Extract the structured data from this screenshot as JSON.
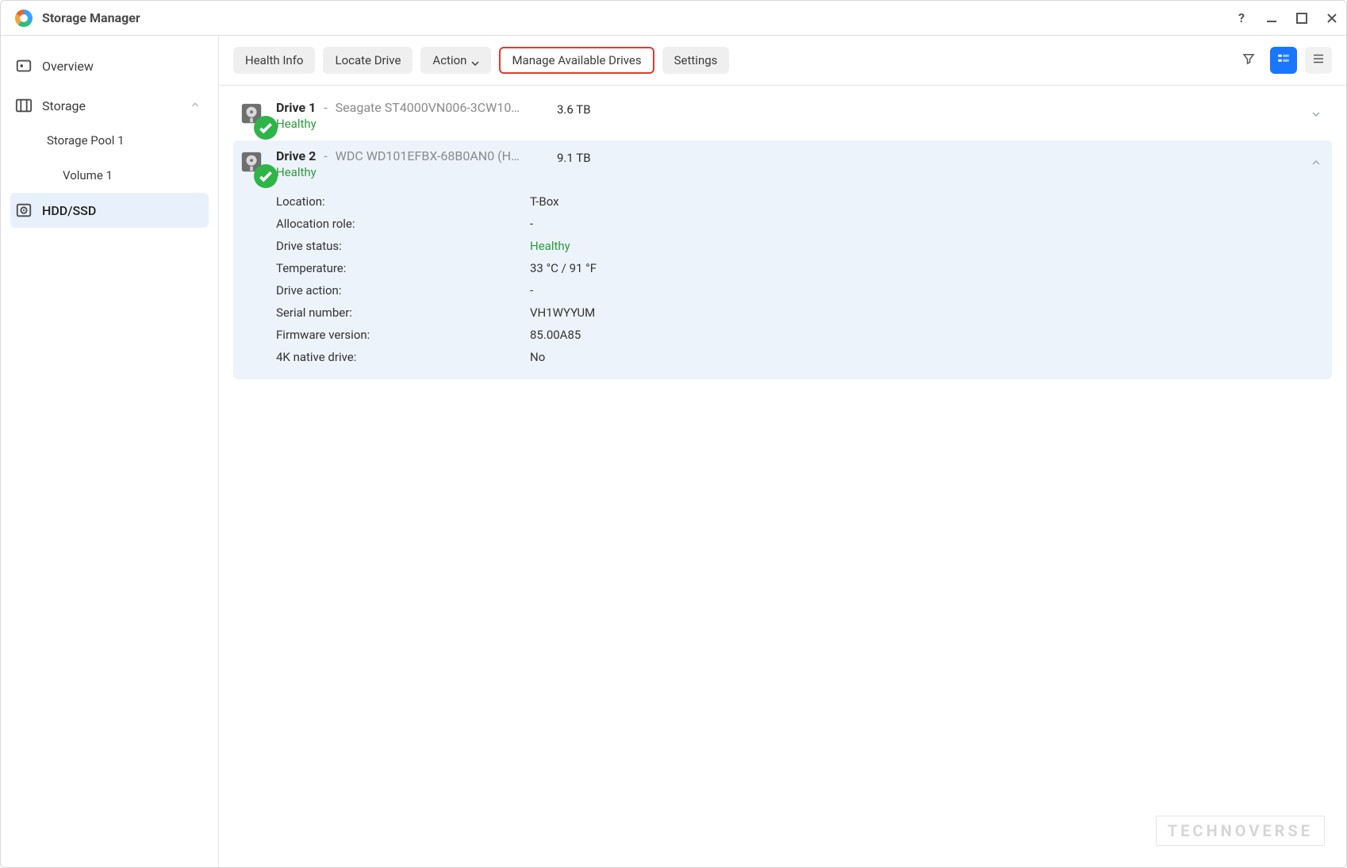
{
  "window": {
    "title": "Storage Manager"
  },
  "sidebar": {
    "overview": {
      "label": "Overview"
    },
    "storage": {
      "label": "Storage"
    },
    "storage_pool": {
      "label": "Storage Pool 1"
    },
    "volume": {
      "label": "Volume 1"
    },
    "hdd_ssd": {
      "label": "HDD/SSD"
    }
  },
  "toolbar": {
    "health_info": "Health Info",
    "locate_drive": "Locate Drive",
    "action": "Action",
    "manage_available": "Manage Available Drives",
    "settings": "Settings"
  },
  "drives": [
    {
      "name": "Drive 1",
      "model": "Seagate ST4000VN006-3CW10…",
      "capacity": "3.6 TB",
      "health": "Healthy",
      "expanded": false
    },
    {
      "name": "Drive 2",
      "model": "WDC WD101EFBX-68B0AN0 (H…",
      "capacity": "9.1 TB",
      "health": "Healthy",
      "expanded": true,
      "details": {
        "location_label": "Location:",
        "location": "T-Box",
        "allocation_label": "Allocation role:",
        "allocation": "-",
        "status_label": "Drive status:",
        "status": "Healthy",
        "temp_label": "Temperature:",
        "temp": "33 °C / 91 °F",
        "action_label": "Drive action:",
        "action": "-",
        "serial_label": "Serial number:",
        "serial": "VH1WYYUM",
        "firmware_label": "Firmware version:",
        "firmware": "85.00A85",
        "native4k_label": "4K native drive:",
        "native4k": "No"
      }
    }
  ],
  "watermark": "TECHNOVERSE"
}
